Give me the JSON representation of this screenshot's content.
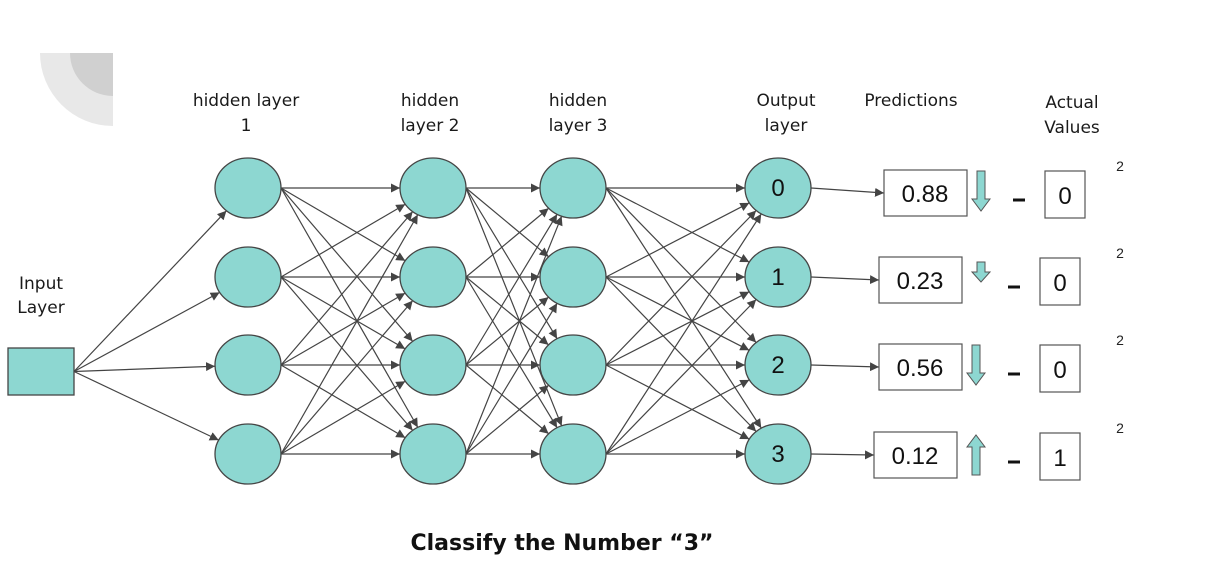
{
  "caption": "Classify the Number “3”",
  "colors": {
    "node_fill": "#8dd7d1",
    "edge": "#444444",
    "deco_outer": "#e8e8e8",
    "deco_inner": "#d0d0d0"
  },
  "layers": {
    "input": {
      "label_lines": [
        "Input",
        "Layer"
      ],
      "node_count": 1
    },
    "hidden1": {
      "label_lines": [
        "hidden layer",
        "1"
      ],
      "node_count": 4
    },
    "hidden2": {
      "label_lines": [
        "hidden",
        "layer 2"
      ],
      "node_count": 4
    },
    "hidden3": {
      "label_lines": [
        "hidden",
        "layer 3"
      ],
      "node_count": 4
    },
    "output": {
      "label_lines": [
        "Output",
        "layer"
      ],
      "node_count": 4,
      "node_labels": [
        "0",
        "1",
        "2",
        "3"
      ]
    }
  },
  "predictions_header": "Predictions",
  "actual_header_lines": [
    "Actual",
    "Values"
  ],
  "rows": [
    {
      "output": "0",
      "prediction": "0.88",
      "direction": "down",
      "arrow_size": "large",
      "minus": "-",
      "actual": "0",
      "exponent": "2"
    },
    {
      "output": "1",
      "prediction": "0.23",
      "direction": "down",
      "arrow_size": "small",
      "minus": "-",
      "actual": "0",
      "exponent": "2"
    },
    {
      "output": "2",
      "prediction": "0.56",
      "direction": "down",
      "arrow_size": "large",
      "minus": "-",
      "actual": "0",
      "exponent": "2"
    },
    {
      "output": "3",
      "prediction": "0.12",
      "direction": "up",
      "arrow_size": "large",
      "minus": "-",
      "actual": "1",
      "exponent": "2"
    }
  ]
}
